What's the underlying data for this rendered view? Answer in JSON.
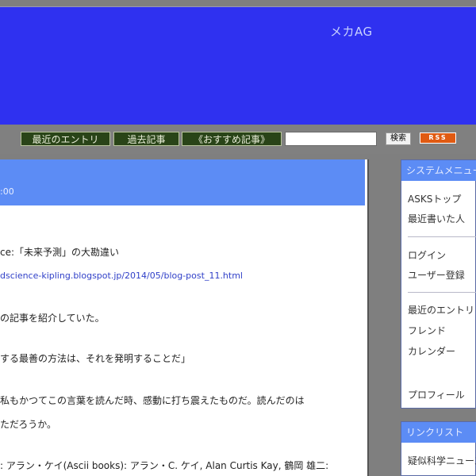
{
  "header": {
    "blog_title": "メカAG"
  },
  "nav": {
    "items": [
      {
        "label": "最近のエントリ"
      },
      {
        "label": "過去記事"
      },
      {
        "label": "《おすすめ記事》"
      }
    ],
    "search": {
      "value": "",
      "button_label": "検索"
    },
    "rss_label": "RSS"
  },
  "entry": {
    "time": ":00",
    "lines": [
      "ce:「未来予測」の大勘違い",
      "の記事を紹介していた。",
      "する最善の方法は、それを発明することだ」",
      "私もかつてこの言葉を読んだ時、感動に打ち震えたものだ。読んだのは",
      "ただろうか。",
      ": アラン・ケイ(Ascii books): アラン・C. ケイ, Alan Curtis Kay, 鶴岡 雄二:"
    ],
    "link": "dscience-kipling.blogspot.jp/2014/05/blog-post_11.html"
  },
  "sidebar": {
    "system_menu": {
      "title": "システムメニュー",
      "items": [
        {
          "label": "ASKSトップ"
        },
        {
          "label": "最近書いた人"
        },
        {
          "label": "ログイン"
        },
        {
          "label": "ユーザー登録"
        },
        {
          "label": "最近のエントリ"
        },
        {
          "label": "フレンド"
        },
        {
          "label": "カレンダー"
        },
        {
          "label": "プロフィール"
        }
      ]
    },
    "link_list": {
      "title": "リンクリスト",
      "items": [
        {
          "label": "疑似科学ニュース"
        }
      ]
    }
  }
}
